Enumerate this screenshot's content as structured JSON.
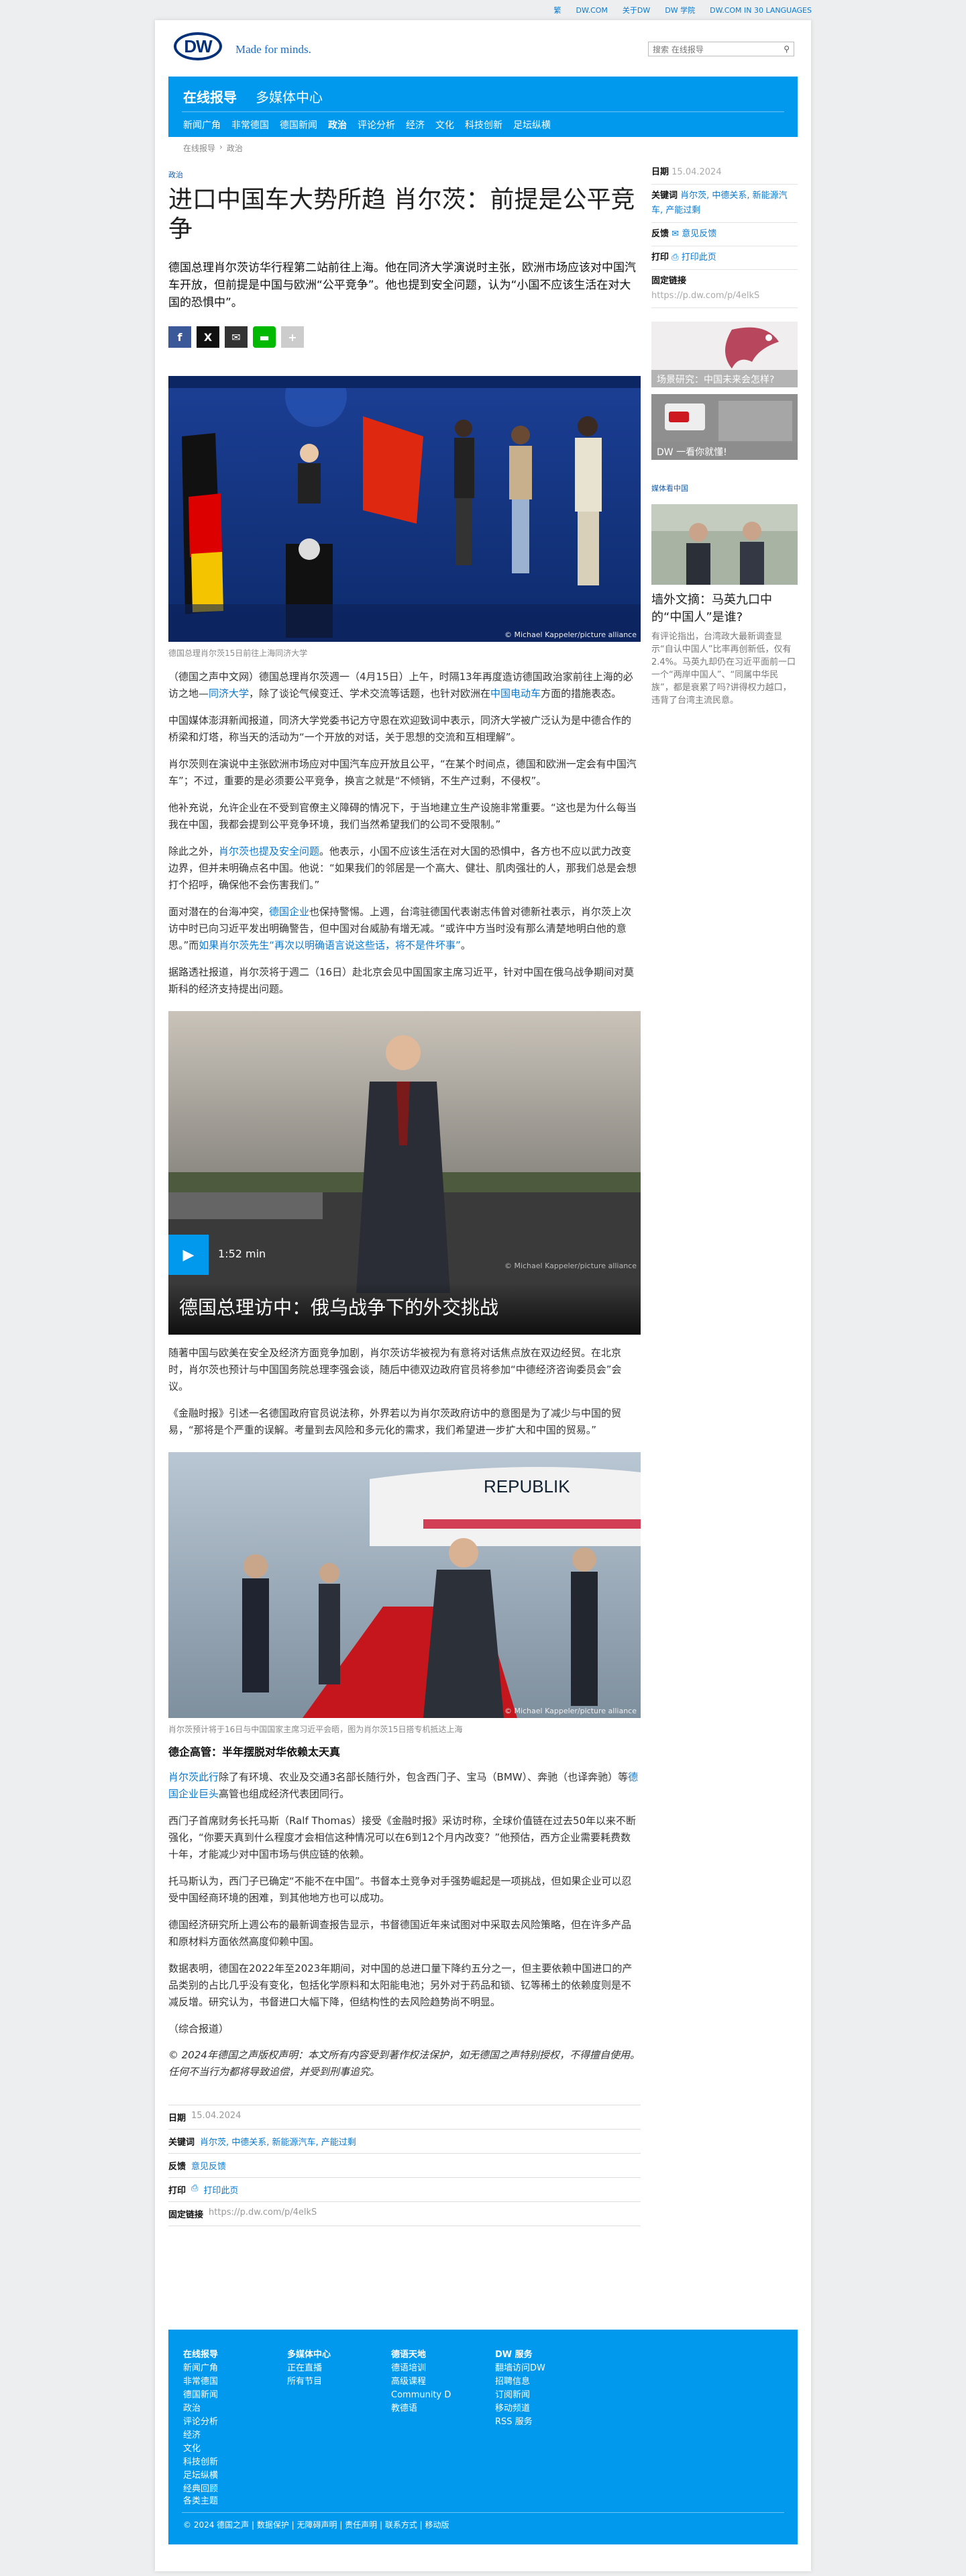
{
  "topbar": {
    "links": [
      "繁",
      "DW.COM",
      "关于DW",
      "DW 学院",
      "DW.COM IN 30 LANGUAGES"
    ]
  },
  "header": {
    "logo": "DW",
    "tagline": "Made for minds.",
    "search_placeholder": "搜索 在线报导"
  },
  "nav": {
    "main": [
      "在线报导",
      "多媒体中心"
    ],
    "sub": [
      "新闻广角",
      "非常德国",
      "德国新闻",
      "政治",
      "评论分析",
      "经济",
      "文化",
      "科技创新",
      "足坛纵横"
    ]
  },
  "breadcrumb": [
    "在线报导",
    "政治"
  ],
  "article": {
    "kicker": "政治",
    "title": "进口中国车大势所趋 肖尔茨：前提是公平竞争",
    "lead": "德国总理肖尔茨访华行程第二站前往上海。他在同济大学演说时主张，欧洲市场应该对中国汽车开放，但前提是中国与欧洲“公平竞争”。他也提到安全问题，认为“小国不应该生活在对大国的恐惧中”。",
    "photo1_credit": "© Michael Kappeler/picture alliance",
    "photo1_caption": "德国总理肖尔茨15日前往上海同济大学",
    "paragraphs_a": [
      {
        "pre": "（德国之声中文网）德国总理肖尔茨週一（4月15日）上午，时隔13年再度造访德国政治家前往上海的必访之地—",
        "link": "同济大学",
        "post": "，除了谈论气候变迁、学术交流等话题，也针对欧洲在",
        "link2": "中国电动车",
        "post2": "方面的措施表态。"
      },
      {
        "pre": "中国媒体澎湃新闻报道，同济大学党委书记方守恩在欢迎致词中表示，同济大学被广泛认为是中德合作的桥梁和灯塔，称当天的活动为“一个开放的对话，关于思想的交流和互相理解”。"
      },
      {
        "pre": "肖尔茨则在演说中主张欧洲市场应对中国汽车应开放且公平，“在某个时间点，德国和欧洲一定会有中国汽车”；不过，重要的是必须要公平竞争，换言之就是“不倾销，不生产过剩，不侵权”。"
      },
      {
        "pre": "他补充说，允许企业在不受到官僚主义障碍的情况下，于当地建立生产设施非常重要。“这也是为什么每当我在中国，我都会提到公平竞争环境，我们当然希望我们的公司不受限制。”"
      },
      {
        "pre": "除此之外，",
        "link": "肖尔茨也提及安全问题",
        "post": "。他表示，小国不应该生活在对大国的恐惧中，各方也不应以武力改变边界，但并未明确点名中国。他说：“如果我们的邻居是一个高大、健壮、肌肉强壮的人，那我们总是会想打个招呼，确保他不会伤害我们。”"
      },
      {
        "pre": "面对潜在的台海冲突，",
        "link": "德国企业",
        "post": "也保持警惕。上週，台湾驻德国代表谢志伟曾对德新社表示，肖尔茨上次访中时已向习近平发出明确警告，但中国对台威胁有增无减。“或许中方当时没有那么清楚地明白他的意思。”而",
        "link2": "如果肖尔茨先生“再次以明确语言说这些话，将不是件坏事”",
        "post2": "。"
      },
      {
        "pre": "据路透社报道，肖尔茨将于週二（16日）赴北京会见中国国家主席习近平，针对中国在俄乌战争期间对莫斯科的经济支持提出问题。"
      }
    ],
    "video": {
      "title": "德国总理访中：俄乌战争下的外交挑战",
      "duration": "1:52 min",
      "credit": "© Michael Kappeler/picture alliance"
    },
    "paragraphs_b": [
      {
        "pre": "随著中国与欧美在安全及经济方面竞争加剧，肖尔茨访华被视为有意将对话焦点放在双边经贸。在北京时，肖尔茨也预计与中国国务院总理李强会谈，随后中德双边政府官员将参加“中德经济咨询委员会”会议。"
      },
      {
        "pre": "《金融时报》引述一名德国政府官员说法称，外界若以为肖尔茨政府访中的意图是为了减少与中国的贸易，“那将是个严重的误解。考量到去风险和多元化的需求，我们希望进一步扩大和中国的贸易。”"
      }
    ],
    "photo2_credit": "© Michael Kappeler/picture alliance",
    "photo2_caption": "肖尔茨预计将于16日与中国国家主席习近平会晤，图为肖尔茨15日搭专机抵达上海",
    "subhead": "德企高管：半年摆脱对华依赖太天真",
    "paragraphs_c": [
      {
        "pre": "",
        "link": "肖尔茨此行",
        "post": "除了有环境、农业及交通3名部长随行外，包含西门子、宝马（BMW）、奔驰（也译奔驰）等",
        "link2": "德国企业巨头",
        "post2": "高管也组成经济代表团同行。"
      },
      {
        "pre": "西门子首席财务长托马斯（Ralf Thomas）接受《金融时报》采访时称，全球价值链在过去50年以来不断强化，“你要天真到什么程度才会相信这种情况可以在6到12个月内改变？”他预估，西方企业需要耗费数十年，才能减少对中国市场与供应链的依赖。"
      },
      {
        "pre": "托马斯认为，西门子已确定“不能不在中国”。书督本土竞争对手强势崛起是一项挑战，但如果企业可以忍受中国经商环境的困难，到其他地方也可以成功。"
      },
      {
        "pre": "德国经济研究所上週公布的最新调查报告显示，书督德国近年来试图对中采取去风险策略，但在许多产品和原材料方面依然高度仰赖中国。"
      },
      {
        "pre": "数据表明，德国在2022年至2023年期间，对中国的总进口量下降约五分之一，但主要依赖中国进口的产品类别的占比几乎没有变化，包括化学原料和太阳能电池；另外对于药品和锁、钇等稀土的依赖度则是不减反增。研究认为，书督进口大幅下降，但结构性的去风险趋势尚不明显。"
      },
      {
        "pre": "（综合报道）"
      }
    ],
    "disclaimer": "© 2024年德国之声版权声明：本文所有内容受到著作权法保护，如无德国之声特别授权，不得擅自使用。任何不当行为都将导致追偿，并受到刑事追究。"
  },
  "meta": {
    "date_label": "日期",
    "date": "15.04.2024",
    "keywords_label": "关键词",
    "keywords": "肖尔茨, 中德关系, 新能源汽车, 产能过剩",
    "feedback_label": "反馈",
    "feedback": "意见反馈",
    "print_label": "打印",
    "print": "打印此页",
    "permalink_label": "固定链接",
    "permalink": "https://p.dw.com/p/4elkS"
  },
  "sidebar": {
    "promo1": "场景研究：中国未来会怎样?",
    "promo2": "DW 一看你就懂!",
    "section": "媒体看中国",
    "story_title": "墙外文摘：马英九口中的“中国人”是谁?",
    "story_text": "有评论指出，台湾政大最新调查显示“自认中国人”比率再创新低，仅有2.4%。马英九却仍在习近平面前一口一个“两岸中国人”、“同属中华民族”，都是衰累了吗?讲得权力越口，违背了台湾主流民意。"
  },
  "footer": {
    "columns": [
      {
        "head": "在线报导",
        "items": [
          "新闻广角",
          "非常德国",
          "德国新闻",
          "政治",
          "评论分析",
          "经济",
          "文化",
          "科技创新",
          "足坛纵横",
          "经典回顾"
        ]
      },
      {
        "head": "多媒体中心",
        "items": [
          "正在直播",
          "所有节目"
        ]
      },
      {
        "head": "德语天地",
        "items": [
          "德语培训",
          "高级课程",
          "Community D",
          "教德语"
        ]
      },
      {
        "head": "DW 服务",
        "items": [
          "翻墙访问DW",
          "招聘信息",
          "订阅新闻",
          "移动频道",
          "RSS 服务"
        ]
      }
    ],
    "topics": "各类主题",
    "bottom": "© 2024 德国之声 | 数据保护 | 无障碍声明 | 责任声明 | 联系方式 | 移动版"
  },
  "colors": {
    "brand_blue": "#0099ee",
    "dw_navy": "#05307a",
    "link": "#0a7ad1"
  }
}
